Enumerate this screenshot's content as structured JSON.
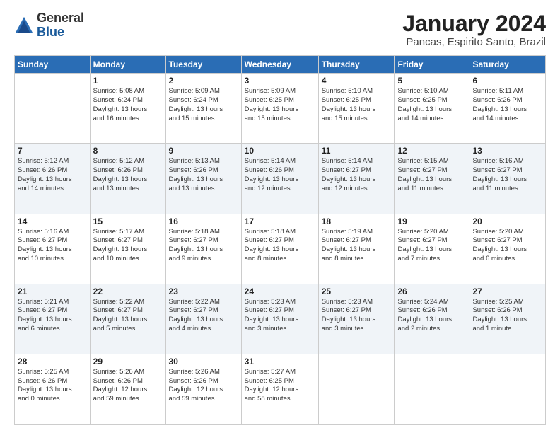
{
  "logo": {
    "general": "General",
    "blue": "Blue"
  },
  "title": "January 2024",
  "location": "Pancas, Espirito Santo, Brazil",
  "columns": [
    "Sunday",
    "Monday",
    "Tuesday",
    "Wednesday",
    "Thursday",
    "Friday",
    "Saturday"
  ],
  "weeks": [
    [
      {
        "day": "",
        "sunrise": "",
        "sunset": "",
        "daylight": ""
      },
      {
        "day": "1",
        "sunrise": "Sunrise: 5:08 AM",
        "sunset": "Sunset: 6:24 PM",
        "daylight": "Daylight: 13 hours and 16 minutes."
      },
      {
        "day": "2",
        "sunrise": "Sunrise: 5:09 AM",
        "sunset": "Sunset: 6:24 PM",
        "daylight": "Daylight: 13 hours and 15 minutes."
      },
      {
        "day": "3",
        "sunrise": "Sunrise: 5:09 AM",
        "sunset": "Sunset: 6:25 PM",
        "daylight": "Daylight: 13 hours and 15 minutes."
      },
      {
        "day": "4",
        "sunrise": "Sunrise: 5:10 AM",
        "sunset": "Sunset: 6:25 PM",
        "daylight": "Daylight: 13 hours and 15 minutes."
      },
      {
        "day": "5",
        "sunrise": "Sunrise: 5:10 AM",
        "sunset": "Sunset: 6:25 PM",
        "daylight": "Daylight: 13 hours and 14 minutes."
      },
      {
        "day": "6",
        "sunrise": "Sunrise: 5:11 AM",
        "sunset": "Sunset: 6:26 PM",
        "daylight": "Daylight: 13 hours and 14 minutes."
      }
    ],
    [
      {
        "day": "7",
        "sunrise": "Sunrise: 5:12 AM",
        "sunset": "Sunset: 6:26 PM",
        "daylight": "Daylight: 13 hours and 14 minutes."
      },
      {
        "day": "8",
        "sunrise": "Sunrise: 5:12 AM",
        "sunset": "Sunset: 6:26 PM",
        "daylight": "Daylight: 13 hours and 13 minutes."
      },
      {
        "day": "9",
        "sunrise": "Sunrise: 5:13 AM",
        "sunset": "Sunset: 6:26 PM",
        "daylight": "Daylight: 13 hours and 13 minutes."
      },
      {
        "day": "10",
        "sunrise": "Sunrise: 5:14 AM",
        "sunset": "Sunset: 6:26 PM",
        "daylight": "Daylight: 13 hours and 12 minutes."
      },
      {
        "day": "11",
        "sunrise": "Sunrise: 5:14 AM",
        "sunset": "Sunset: 6:27 PM",
        "daylight": "Daylight: 13 hours and 12 minutes."
      },
      {
        "day": "12",
        "sunrise": "Sunrise: 5:15 AM",
        "sunset": "Sunset: 6:27 PM",
        "daylight": "Daylight: 13 hours and 11 minutes."
      },
      {
        "day": "13",
        "sunrise": "Sunrise: 5:16 AM",
        "sunset": "Sunset: 6:27 PM",
        "daylight": "Daylight: 13 hours and 11 minutes."
      }
    ],
    [
      {
        "day": "14",
        "sunrise": "Sunrise: 5:16 AM",
        "sunset": "Sunset: 6:27 PM",
        "daylight": "Daylight: 13 hours and 10 minutes."
      },
      {
        "day": "15",
        "sunrise": "Sunrise: 5:17 AM",
        "sunset": "Sunset: 6:27 PM",
        "daylight": "Daylight: 13 hours and 10 minutes."
      },
      {
        "day": "16",
        "sunrise": "Sunrise: 5:18 AM",
        "sunset": "Sunset: 6:27 PM",
        "daylight": "Daylight: 13 hours and 9 minutes."
      },
      {
        "day": "17",
        "sunrise": "Sunrise: 5:18 AM",
        "sunset": "Sunset: 6:27 PM",
        "daylight": "Daylight: 13 hours and 8 minutes."
      },
      {
        "day": "18",
        "sunrise": "Sunrise: 5:19 AM",
        "sunset": "Sunset: 6:27 PM",
        "daylight": "Daylight: 13 hours and 8 minutes."
      },
      {
        "day": "19",
        "sunrise": "Sunrise: 5:20 AM",
        "sunset": "Sunset: 6:27 PM",
        "daylight": "Daylight: 13 hours and 7 minutes."
      },
      {
        "day": "20",
        "sunrise": "Sunrise: 5:20 AM",
        "sunset": "Sunset: 6:27 PM",
        "daylight": "Daylight: 13 hours and 6 minutes."
      }
    ],
    [
      {
        "day": "21",
        "sunrise": "Sunrise: 5:21 AM",
        "sunset": "Sunset: 6:27 PM",
        "daylight": "Daylight: 13 hours and 6 minutes."
      },
      {
        "day": "22",
        "sunrise": "Sunrise: 5:22 AM",
        "sunset": "Sunset: 6:27 PM",
        "daylight": "Daylight: 13 hours and 5 minutes."
      },
      {
        "day": "23",
        "sunrise": "Sunrise: 5:22 AM",
        "sunset": "Sunset: 6:27 PM",
        "daylight": "Daylight: 13 hours and 4 minutes."
      },
      {
        "day": "24",
        "sunrise": "Sunrise: 5:23 AM",
        "sunset": "Sunset: 6:27 PM",
        "daylight": "Daylight: 13 hours and 3 minutes."
      },
      {
        "day": "25",
        "sunrise": "Sunrise: 5:23 AM",
        "sunset": "Sunset: 6:27 PM",
        "daylight": "Daylight: 13 hours and 3 minutes."
      },
      {
        "day": "26",
        "sunrise": "Sunrise: 5:24 AM",
        "sunset": "Sunset: 6:26 PM",
        "daylight": "Daylight: 13 hours and 2 minutes."
      },
      {
        "day": "27",
        "sunrise": "Sunrise: 5:25 AM",
        "sunset": "Sunset: 6:26 PM",
        "daylight": "Daylight: 13 hours and 1 minute."
      }
    ],
    [
      {
        "day": "28",
        "sunrise": "Sunrise: 5:25 AM",
        "sunset": "Sunset: 6:26 PM",
        "daylight": "Daylight: 13 hours and 0 minutes."
      },
      {
        "day": "29",
        "sunrise": "Sunrise: 5:26 AM",
        "sunset": "Sunset: 6:26 PM",
        "daylight": "Daylight: 12 hours and 59 minutes."
      },
      {
        "day": "30",
        "sunrise": "Sunrise: 5:26 AM",
        "sunset": "Sunset: 6:26 PM",
        "daylight": "Daylight: 12 hours and 59 minutes."
      },
      {
        "day": "31",
        "sunrise": "Sunrise: 5:27 AM",
        "sunset": "Sunset: 6:25 PM",
        "daylight": "Daylight: 12 hours and 58 minutes."
      },
      {
        "day": "",
        "sunrise": "",
        "sunset": "",
        "daylight": ""
      },
      {
        "day": "",
        "sunrise": "",
        "sunset": "",
        "daylight": ""
      },
      {
        "day": "",
        "sunrise": "",
        "sunset": "",
        "daylight": ""
      }
    ]
  ]
}
